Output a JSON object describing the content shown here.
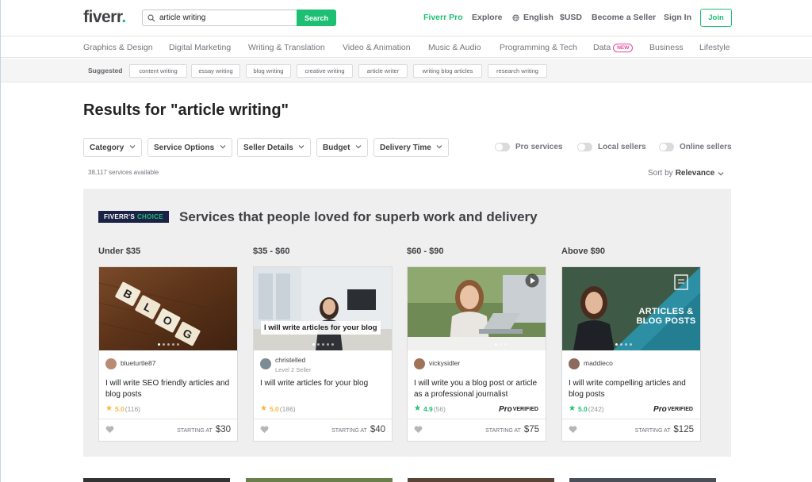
{
  "header": {
    "logo": "fiverr",
    "logo_dot": ".",
    "search_value": "article writing",
    "search_button": "Search",
    "nav": {
      "pro": "Fiverr Pro",
      "explore": "Explore",
      "language": "English",
      "currency": "$USD",
      "seller": "Become a Seller",
      "signin": "Sign In",
      "join": "Join"
    }
  },
  "categories": [
    "Graphics & Design",
    "Digital Marketing",
    "Writing & Translation",
    "Video & Animation",
    "Music & Audio",
    "Programming & Tech",
    "Data",
    "Business",
    "Lifestyle"
  ],
  "new_badge": "NEW",
  "suggested": {
    "label": "Suggested",
    "chips": [
      "content writing",
      "essay writing",
      "blog writing",
      "creative writing",
      "article writer",
      "writing blog articles",
      "research writing"
    ]
  },
  "results_title": "Results for \"article writing\"",
  "filters": [
    "Category",
    "Service Options",
    "Seller Details",
    "Budget",
    "Delivery Time"
  ],
  "toggles": [
    "Pro services",
    "Local sellers",
    "Online sellers"
  ],
  "count": "38,117 services available",
  "sort": {
    "label": "Sort by",
    "value": "Relevance"
  },
  "choice": {
    "badge_a": "FIVERR'S",
    "badge_b": "CHOICE",
    "title": "Services that people loved for superb work and delivery",
    "tiers": [
      "Under $35",
      "$35 - $60",
      "$60 - $90",
      "Above $90"
    ],
    "cards": [
      {
        "seller": "blueturtle87",
        "level": "",
        "title": "I will write SEO friendly articles and blog posts",
        "score": "5.0",
        "reviews": "(116)",
        "pro": "",
        "starting": "STARTING AT",
        "price": "$30",
        "star_color": "#ffb33e"
      },
      {
        "seller": "christelled",
        "level": "Level 2 Seller",
        "title": "I will write articles for your blog",
        "score": "5.0",
        "reviews": "(186)",
        "pro": "",
        "starting": "STARTING AT",
        "price": "$40",
        "star_color": "#ffb33e",
        "overlay": "I will write articles for your blog"
      },
      {
        "seller": "vickysidler",
        "level": "",
        "title": "I will write you a blog post or article as a professional journalist",
        "score": "4.9",
        "reviews": "(56)",
        "pro": "VERIFIED",
        "pro_mark": "Pro",
        "starting": "STARTING AT",
        "price": "$75",
        "star_color": "#1dbf73"
      },
      {
        "seller": "maddieco",
        "level": "",
        "title": "I will write compelling articles and blog posts",
        "score": "5.0",
        "reviews": "(242)",
        "pro": "VERIFIED",
        "pro_mark": "Pro",
        "starting": "STARTING AT",
        "price": "$125",
        "star_color": "#1dbf73",
        "overlay": "ARTICLES & BLOG POSTS"
      }
    ]
  },
  "colors": {
    "brand": "#1dbf73",
    "badge_bg": "#1b2147",
    "new": "#e54997"
  },
  "blog_tiles": [
    "B",
    "L",
    "O",
    "G"
  ]
}
